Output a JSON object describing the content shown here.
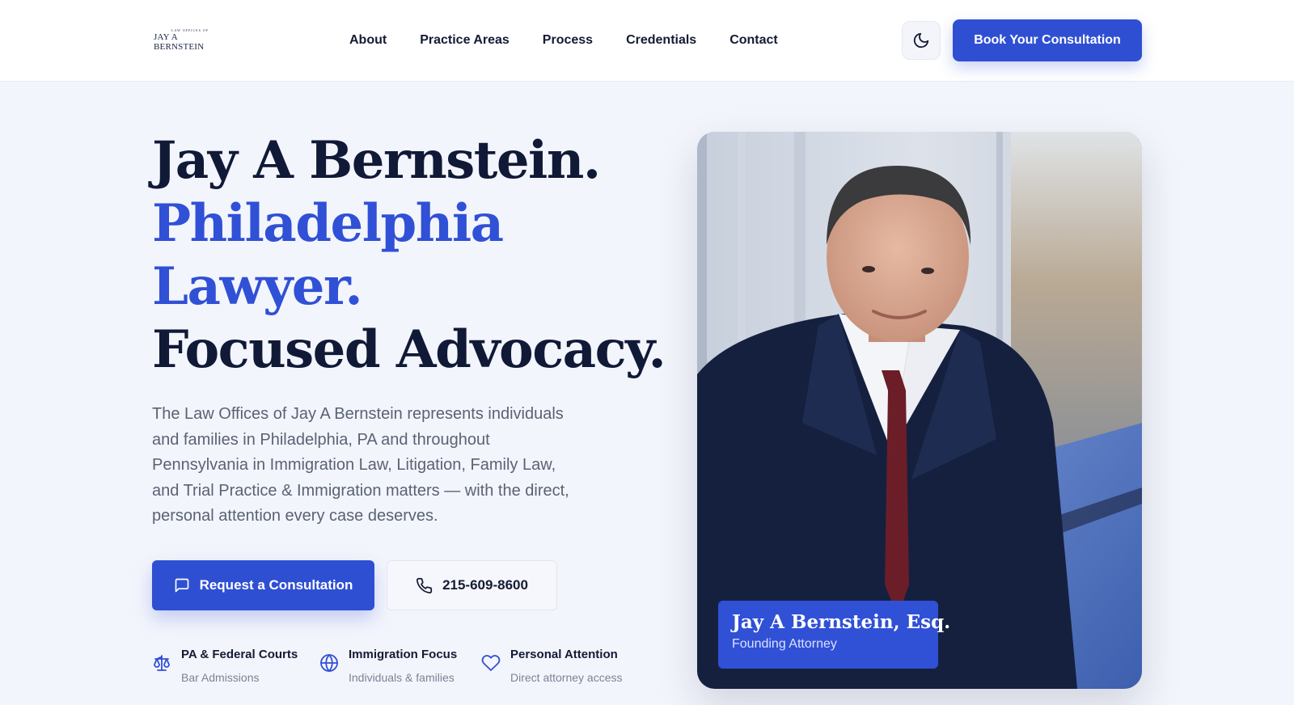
{
  "header": {
    "logo_top": "LAW OFFICES OF",
    "logo_name": "JAY A BERNSTEIN",
    "nav": [
      {
        "label": "About"
      },
      {
        "label": "Practice Areas"
      },
      {
        "label": "Process"
      },
      {
        "label": "Credentials"
      },
      {
        "label": "Contact"
      }
    ],
    "theme_icon": "moon-icon",
    "cta_label": "Book Your Consultation"
  },
  "hero": {
    "line1": "Jay A Bernstein.",
    "line2": "Philadelphia",
    "line3": "Lawyer.",
    "line4": "Focused Advocacy.",
    "lede": "The Law Offices of Jay A Bernstein represents individuals and families in Philadelphia, PA and throughout Pennsylvania in Immigration Law, Litigation, Family Law, and Trial Practice & Immigration matters — with the direct, personal attention every case deserves.",
    "primary_cta": "Request a Consultation",
    "phone": "215-609-8600",
    "features": [
      {
        "icon": "scales-icon",
        "title": "PA & Federal Courts",
        "subtitle": "Bar Admissions"
      },
      {
        "icon": "globe-icon",
        "title": "Immigration Focus",
        "subtitle": "Individuals & families"
      },
      {
        "icon": "heart-icon",
        "title": "Personal Attention",
        "subtitle": "Direct attorney access"
      }
    ]
  },
  "profile": {
    "name": "Jay A Bernstein, Esq.",
    "role": "Founding Attorney"
  },
  "colors": {
    "accent": "#2f4fd3",
    "heading": "#101a37",
    "background": "#f3f5fc"
  }
}
